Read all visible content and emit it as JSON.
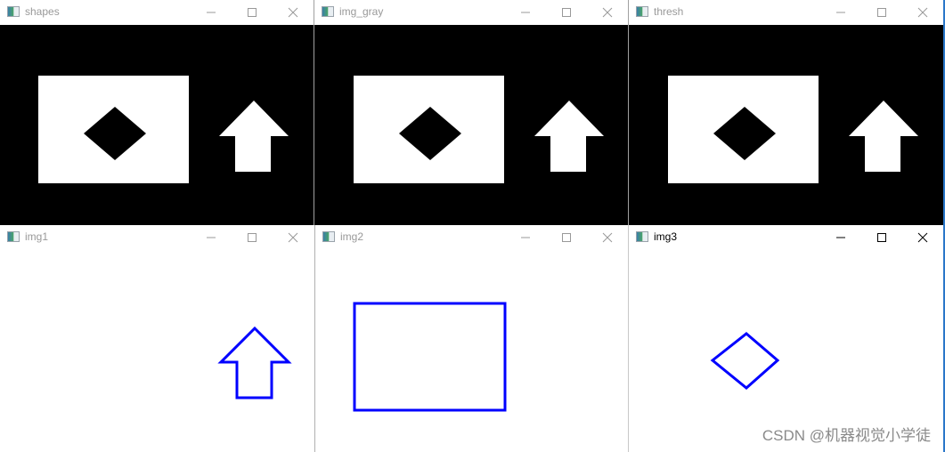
{
  "windows": [
    {
      "id": "shapes",
      "title": "shapes",
      "active": false,
      "content": "binary-black"
    },
    {
      "id": "img_gray",
      "title": "img_gray",
      "active": false,
      "content": "binary-black"
    },
    {
      "id": "thresh",
      "title": "thresh",
      "active": false,
      "content": "binary-black"
    },
    {
      "id": "img1",
      "title": "img1",
      "active": false,
      "content": "contour-arrow"
    },
    {
      "id": "img2",
      "title": "img2",
      "active": false,
      "content": "contour-rect"
    },
    {
      "id": "img3",
      "title": "img3",
      "active": true,
      "content": "contour-diamond"
    }
  ],
  "controls": {
    "minimize": "minimize",
    "maximize": "maximize",
    "close": "close"
  },
  "colors": {
    "contour": "#0000ff",
    "canvas_dark": "#000000",
    "shape_light": "#ffffff"
  },
  "watermark": "CSDN @机器视觉小学徒"
}
